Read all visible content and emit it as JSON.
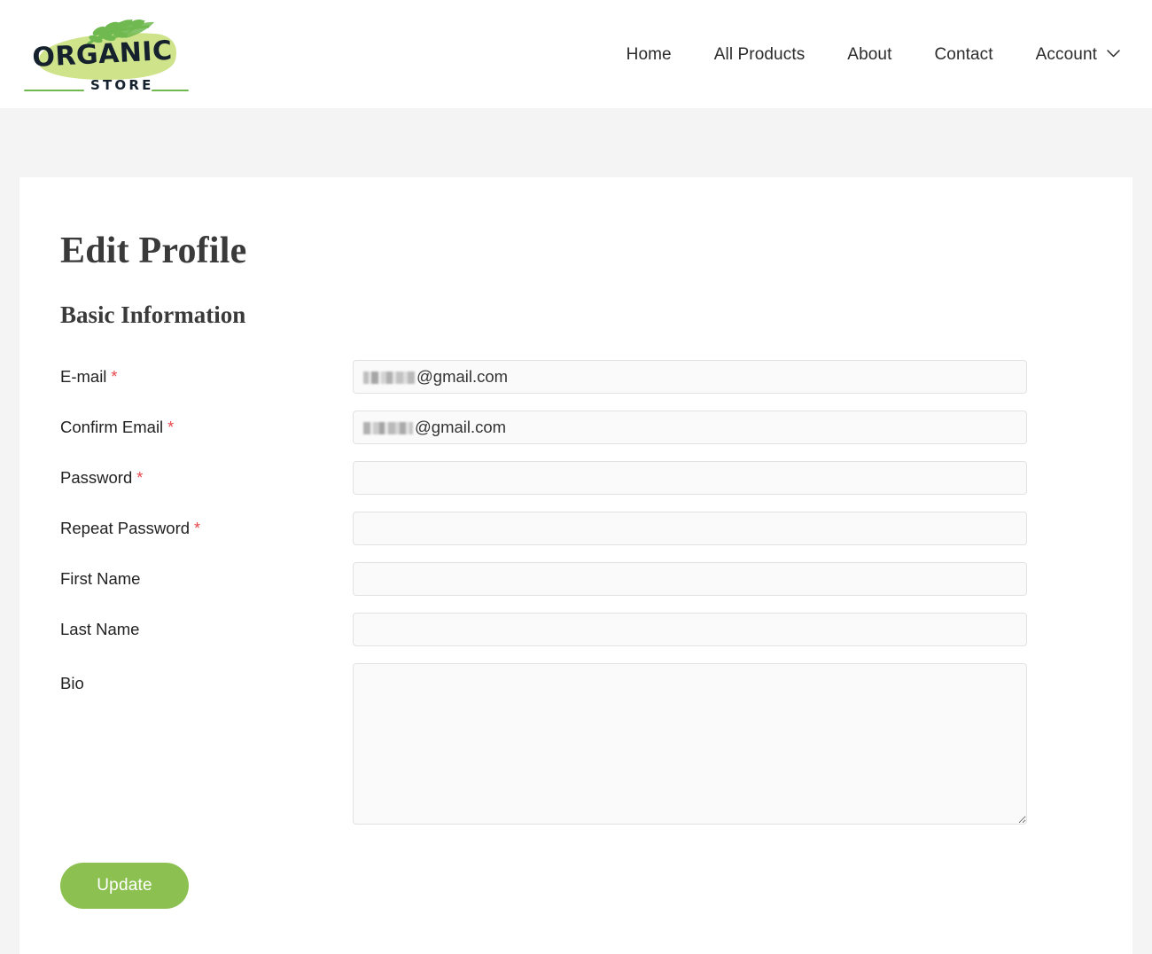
{
  "site": {
    "brand": {
      "name_top": "ORGANIC",
      "name_bottom": "STORE",
      "colors": {
        "text": "#15222e",
        "brush": "#cfe38a",
        "leaf": "#7bbd5a",
        "rule": "#7bbd5a"
      }
    },
    "nav": {
      "items": [
        {
          "label": "Home",
          "has_chevron": false
        },
        {
          "label": "All Products",
          "has_chevron": false
        },
        {
          "label": "About",
          "has_chevron": false
        },
        {
          "label": "Contact",
          "has_chevron": false
        },
        {
          "label": "Account",
          "has_chevron": true
        }
      ],
      "chevron_icon": "chevron-down-icon"
    }
  },
  "page": {
    "title": "Edit Profile",
    "section_title": "Basic Information",
    "background": "#f4f4f4",
    "card_background": "#ffffff"
  },
  "form": {
    "required_marker": "*",
    "fields": [
      {
        "label": "E-mail",
        "required": true,
        "type": "email-readonly",
        "value_domain": "@gmail.com",
        "value_redacted": true,
        "placeholder": ""
      },
      {
        "label": "Confirm Email",
        "required": true,
        "type": "email-readonly",
        "value_domain": "@gmail.com",
        "value_redacted": true,
        "placeholder": ""
      },
      {
        "label": "Password",
        "required": true,
        "type": "password",
        "value": "",
        "placeholder": ""
      },
      {
        "label": "Repeat Password",
        "required": true,
        "type": "password",
        "value": "",
        "placeholder": ""
      },
      {
        "label": "First Name",
        "required": false,
        "type": "text",
        "value": "",
        "placeholder": ""
      },
      {
        "label": "Last Name",
        "required": false,
        "type": "text",
        "value": "",
        "placeholder": ""
      },
      {
        "label": "Bio",
        "required": false,
        "type": "textarea",
        "value": "",
        "placeholder": ""
      }
    ],
    "submit": {
      "label": "Update",
      "color": "#8cc152",
      "text_color": "#ffffff"
    }
  },
  "colors": {
    "required_asterisk": "#e8454b",
    "accent_green": "#8cc152",
    "heading": "#3a3a3a",
    "body_text": "#222222",
    "input_bg": "#fafafa",
    "input_border": "#e2e2e2"
  }
}
